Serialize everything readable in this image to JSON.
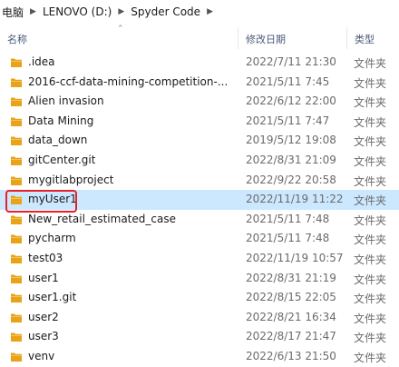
{
  "breadcrumb": [
    {
      "label": "电脑"
    },
    {
      "label": "LENOVO (D:)"
    },
    {
      "label": "Spyder Code"
    }
  ],
  "columns": {
    "name": "名称",
    "date": "修改日期",
    "type": "类型"
  },
  "folder_color": "#e8a317",
  "selection_color": "#cce8ff",
  "annotation_color": "#e8202a",
  "files": [
    {
      "name": ".idea",
      "date": "2022/7/11 21:30",
      "type": "文件夹"
    },
    {
      "name": "2016-ccf-data-mining-competition-...",
      "date": "2021/5/11 7:45",
      "type": "文件夹"
    },
    {
      "name": "Alien invasion",
      "date": "2022/6/12 22:00",
      "type": "文件夹"
    },
    {
      "name": "Data Mining",
      "date": "2021/5/11 7:47",
      "type": "文件夹"
    },
    {
      "name": "data_down",
      "date": "2019/5/12 19:08",
      "type": "文件夹"
    },
    {
      "name": "gitCenter.git",
      "date": "2022/8/31 21:09",
      "type": "文件夹"
    },
    {
      "name": "mygitlabproject",
      "date": "2022/9/22 20:58",
      "type": "文件夹"
    },
    {
      "name": "myUser1",
      "date": "2022/11/19 11:22",
      "type": "文件夹",
      "selected": true
    },
    {
      "name": "New_retail_estimated_case",
      "date": "2021/5/11 7:48",
      "type": "文件夹"
    },
    {
      "name": "pycharm",
      "date": "2021/5/11 7:48",
      "type": "文件夹"
    },
    {
      "name": "test03",
      "date": "2022/11/19 10:57",
      "type": "文件夹"
    },
    {
      "name": "user1",
      "date": "2022/8/31 21:19",
      "type": "文件夹"
    },
    {
      "name": "user1.git",
      "date": "2022/8/15 22:05",
      "type": "文件夹"
    },
    {
      "name": "user2",
      "date": "2022/8/21 16:34",
      "type": "文件夹"
    },
    {
      "name": "user3",
      "date": "2022/8/17 21:47",
      "type": "文件夹"
    },
    {
      "name": "venv",
      "date": "2022/6/13 21:50",
      "type": "文件夹"
    }
  ]
}
